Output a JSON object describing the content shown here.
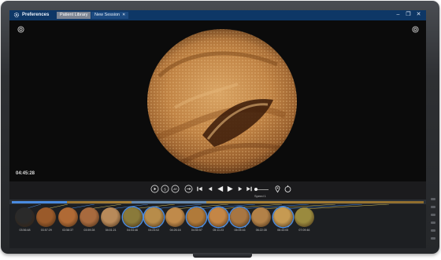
{
  "titlebar": {
    "app_label": "Preferences",
    "tabs": [
      {
        "label": "Patient Library",
        "active": true
      },
      {
        "label": "New Session",
        "active": false
      }
    ],
    "controls": [
      "minimize",
      "restore",
      "close"
    ]
  },
  "video": {
    "timecode": "04:45:28"
  },
  "playback": {
    "speed_label": "Speed 1",
    "buttons": [
      "play-mode",
      "skip-mode",
      "auto-mode",
      "loop",
      "first-frame",
      "step-back",
      "play-reverse",
      "play",
      "step-forward",
      "last-frame"
    ]
  },
  "colors": {
    "titlebar": "#0e3766",
    "accent": "#4a8be0",
    "timeline": "#b3893a"
  },
  "thumbnails": [
    {
      "time": "03:56:48",
      "selected": false
    },
    {
      "time": "03:57:29",
      "selected": false
    },
    {
      "time": "03:58:37",
      "selected": false
    },
    {
      "time": "03:59:28",
      "selected": false
    },
    {
      "time": "04:01:21",
      "selected": false
    },
    {
      "time": "04:04:46",
      "selected": true
    },
    {
      "time": "04:23:02",
      "selected": true
    },
    {
      "time": "04:26:16",
      "selected": false
    },
    {
      "time": "04:50:57",
      "selected": true
    },
    {
      "time": "05:11:23",
      "selected": true
    },
    {
      "time": "06:05:16",
      "selected": true
    },
    {
      "time": "06:22:35",
      "selected": false
    },
    {
      "time": "06:43:05",
      "selected": true
    },
    {
      "time": "07:09:46",
      "selected": false
    }
  ]
}
